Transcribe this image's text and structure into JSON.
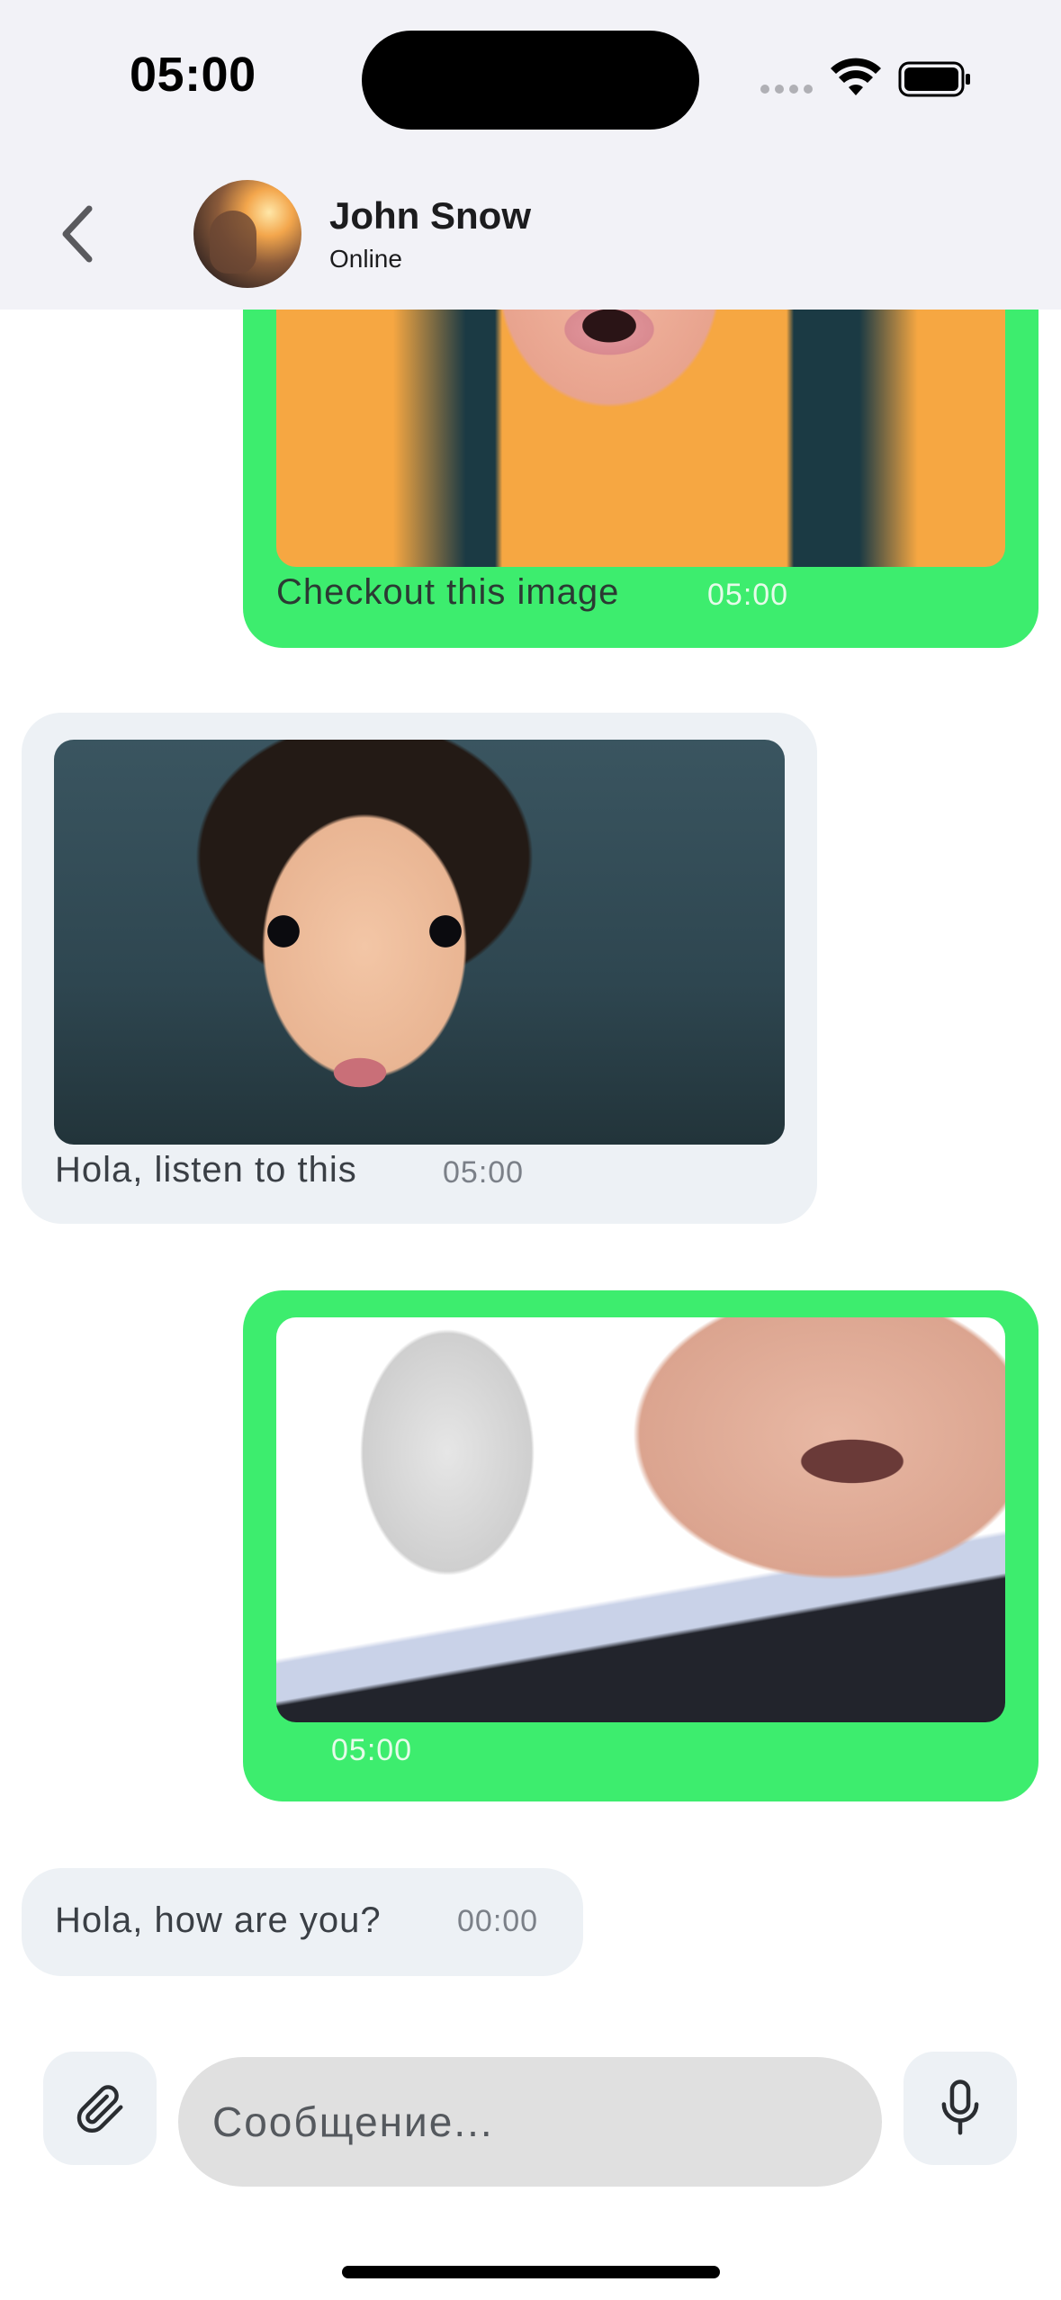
{
  "status_bar": {
    "time": "05:00"
  },
  "header": {
    "back_icon": "chevron-left-icon",
    "contact_name": "John Snow",
    "contact_status": "Online"
  },
  "messages": [
    {
      "direction": "outgoing",
      "has_image": true,
      "image_subject": "girl",
      "text": "Checkout this image",
      "time": "05:00"
    },
    {
      "direction": "incoming",
      "has_image": true,
      "image_subject": "child",
      "text": "Hola, listen to this",
      "time": "05:00"
    },
    {
      "direction": "outgoing",
      "has_image": true,
      "image_subject": "man",
      "text": "",
      "time": "05:00"
    },
    {
      "direction": "incoming",
      "has_image": false,
      "text": "Hola, how are you?",
      "time": "00:00"
    }
  ],
  "composer": {
    "attach_icon": "paperclip-icon",
    "placeholder": "Сообщение...",
    "mic_icon": "microphone-icon"
  },
  "colors": {
    "outgoing_bubble": "#3ded6e",
    "incoming_bubble": "#edf1f5",
    "header_background": "#f2f2f7",
    "input_background": "#e0e0e0"
  }
}
